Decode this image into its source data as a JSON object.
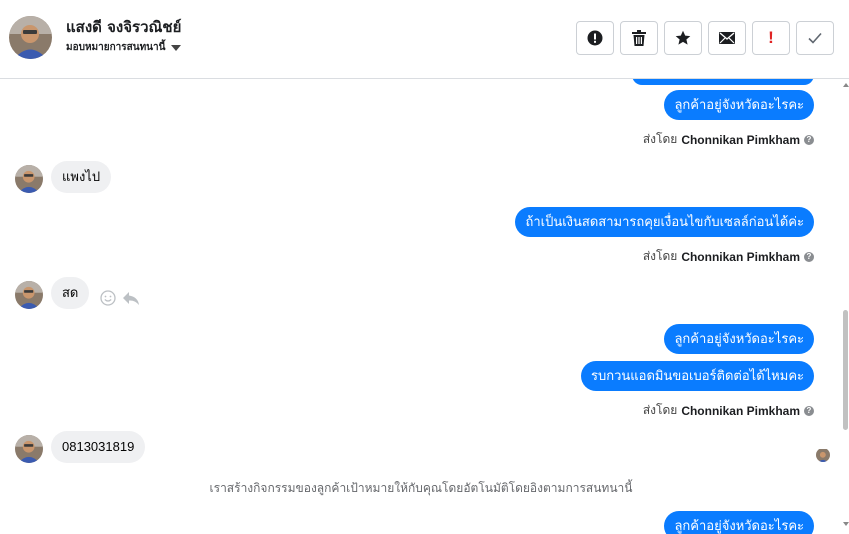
{
  "header": {
    "contact_name": "แสงดี จงจิรวณิชย์",
    "assign_label": "มอบหมายการสนทนานี้",
    "toolbar": [
      {
        "name": "spam-button",
        "icon": "alert-circle-icon"
      },
      {
        "name": "delete-button",
        "icon": "trash-icon"
      },
      {
        "name": "star-button",
        "icon": "star-icon"
      },
      {
        "name": "mark-unread-button",
        "icon": "envelope-icon"
      },
      {
        "name": "follow-up-button",
        "icon": "exclamation-icon"
      },
      {
        "name": "mark-done-button",
        "icon": "checkmark-icon"
      }
    ]
  },
  "colors": {
    "outgoing_bubble": "#0a7cff",
    "incoming_bubble": "#eff0f2",
    "follow_up_red": "#e02424"
  },
  "messages": {
    "out_1": "ลูกค้าอยู่จังหวัดอะไรคะ",
    "sent_by_1": {
      "prefix": "ส่งโดย",
      "agent": "Chonnikan Pimkham"
    },
    "in_1": "แพงไป",
    "out_2": "ถ้าเป็นเงินสดสามารถคุยเงื่อนไขกับเซลล์ก่อนได้ค่ะ",
    "sent_by_2": {
      "prefix": "ส่งโดย",
      "agent": "Chonnikan Pimkham"
    },
    "in_2": "สด",
    "out_3": "ลูกค้าอยู่จังหวัดอะไรคะ",
    "out_4": "รบกวนแอดมินขอเบอร์ติดต่อได้ไหมคะ",
    "sent_by_3": {
      "prefix": "ส่งโดย",
      "agent": "Chonnikan Pimkham"
    },
    "in_3": "0813031819",
    "system_note": "เราสร้างกิจกรรมของลูกค้าเป้าหมายให้กับคุณโดยอัตโนมัติโดยอิงตามการสนทนานี้",
    "out_5": "ลูกค้าอยู่จังหวัดอะไรคะ"
  }
}
